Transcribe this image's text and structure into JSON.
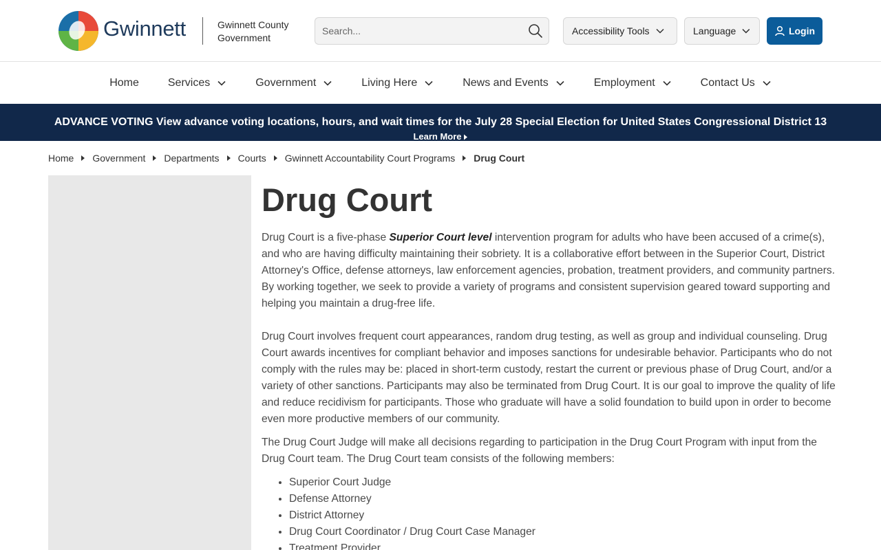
{
  "header": {
    "brand": "Gwinnett",
    "brand_sub_line1": "Gwinnett County",
    "brand_sub_line2": "Government",
    "search_placeholder": "Search...",
    "accessibility_label": "Accessibility Tools",
    "language_label": "Language",
    "login_label": "Login"
  },
  "nav": {
    "items": [
      {
        "label": "Home"
      },
      {
        "label": "Services"
      },
      {
        "label": "Government"
      },
      {
        "label": "Living Here"
      },
      {
        "label": "News and Events"
      },
      {
        "label": "Employment"
      },
      {
        "label": "Contact Us"
      }
    ]
  },
  "alert": {
    "lead": "ADVANCE VOTING",
    "text": "View advance voting locations, hours, and wait times for the July 28 Special Election for United States Congressional District 13",
    "more": "Learn More"
  },
  "breadcrumb": {
    "items": [
      "Home",
      "Government",
      "Departments",
      "Courts",
      "Gwinnett Accountability Court Programs",
      "Drug Court"
    ]
  },
  "main": {
    "title": "Drug Court",
    "p1_before": "Drug Court is a five-phase ",
    "p1_em": "Superior Court level",
    "p1_after": " intervention program for adults who have been accused of a crime(s), and who are having difficulty maintaining their sobriety. It is a collaborative effort between in the Superior Court, District Attorney's Office, defense attorneys, law enforcement agencies, probation, treatment providers, and community partners. By working together, we seek to provide a variety of programs and consistent supervision geared toward supporting and helping you maintain a drug-free life.",
    "p2": "Drug Court involves frequent court appearances, random drug testing, as well as group and individual counseling. Drug Court awards incentives for compliant behavior and imposes sanctions for undesirable behavior. Participants who do not comply with the rules may be: placed in short-term custody, restart the current or previous phase of Drug Court, and/or a variety of other sanctions. Participants may also be terminated from Drug Court. It is our goal to improve the quality of life and reduce recidivism for participants. Those who graduate will have a solid foundation to build upon in order to become even more productive members of our community.",
    "p3": "The Drug Court Judge will make all decisions regarding to participation in the Drug Court Program with input from the Drug Court team. The Drug Court team consists of the following members:",
    "members": [
      "Superior Court Judge",
      "Defense Attorney",
      "District Attorney",
      "Drug Court Coordinator / Drug Court Case Manager",
      "Treatment Provider"
    ]
  },
  "colors": {
    "primary_blue": "#0b5c9a",
    "alert_bg": "#11284a",
    "sidebar_bg": "#e8e8e8"
  }
}
